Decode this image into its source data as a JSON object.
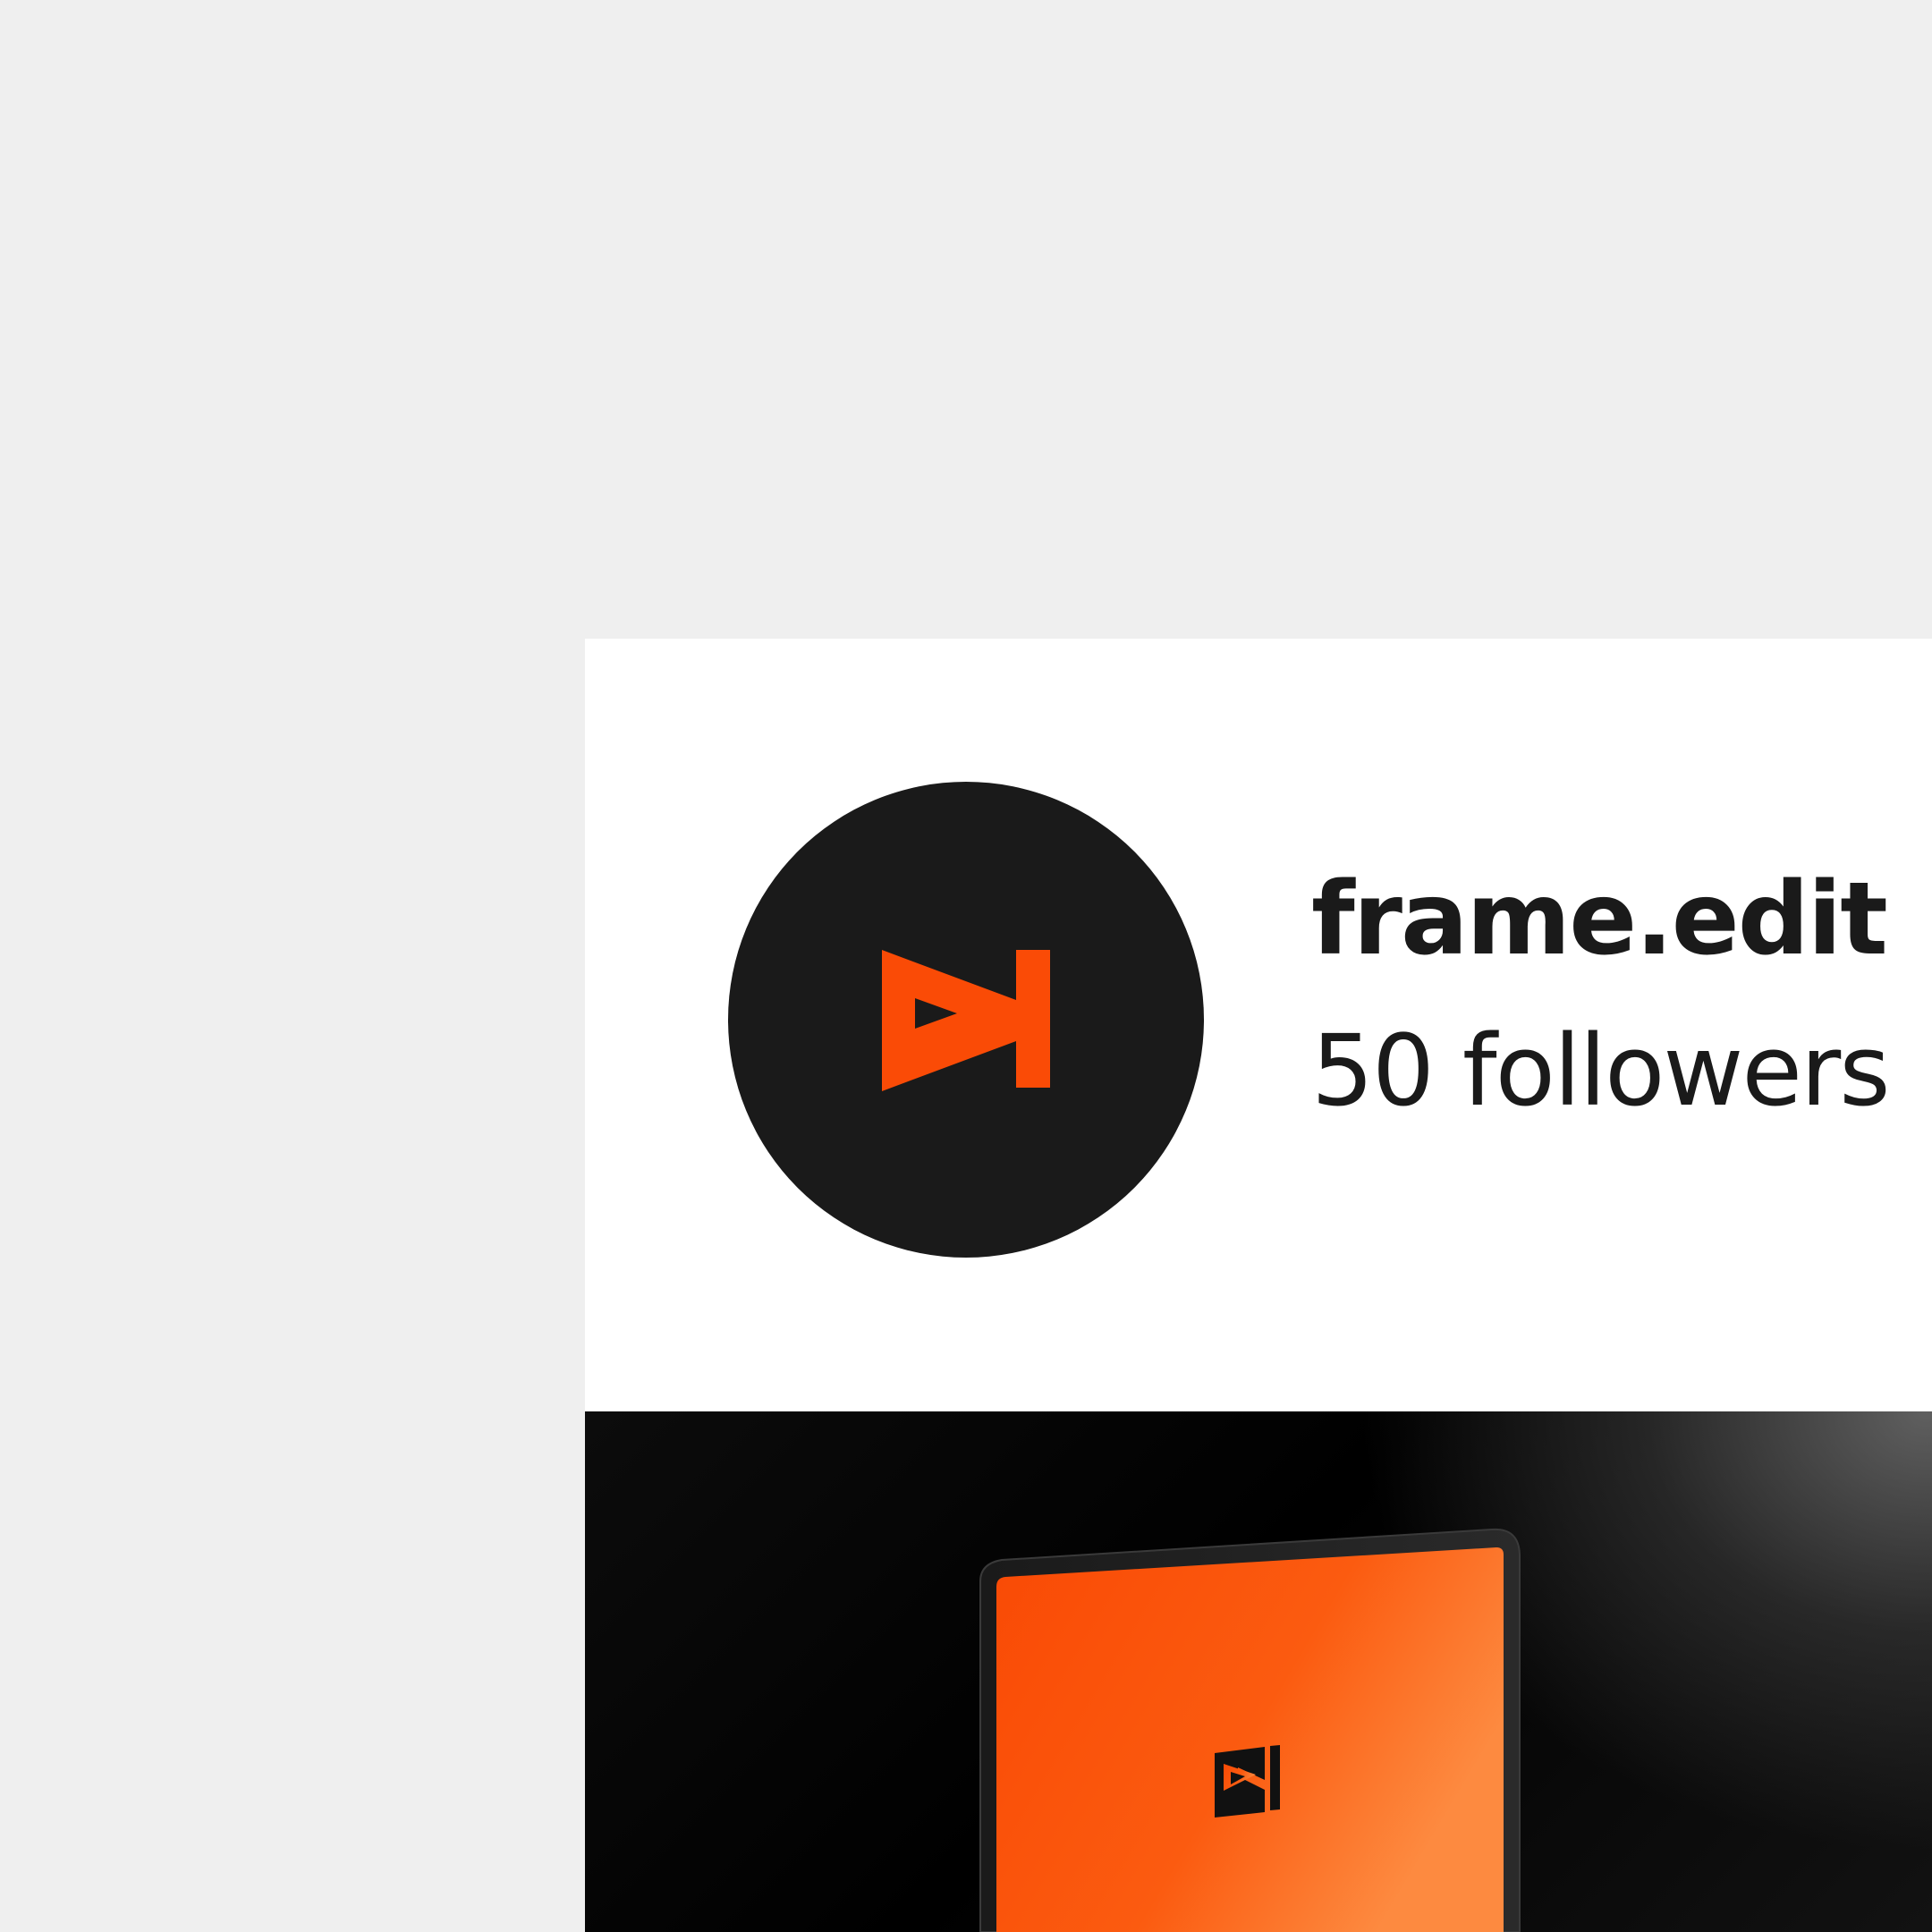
{
  "profile": {
    "name": "frame.edit",
    "followers": "50 followers"
  },
  "colors": {
    "brand_orange": "#fa4b06",
    "avatar_background": "#1a1a1a",
    "text": "#1a1a1a"
  },
  "icons": {
    "logo": "frame-edit-logo-icon"
  }
}
